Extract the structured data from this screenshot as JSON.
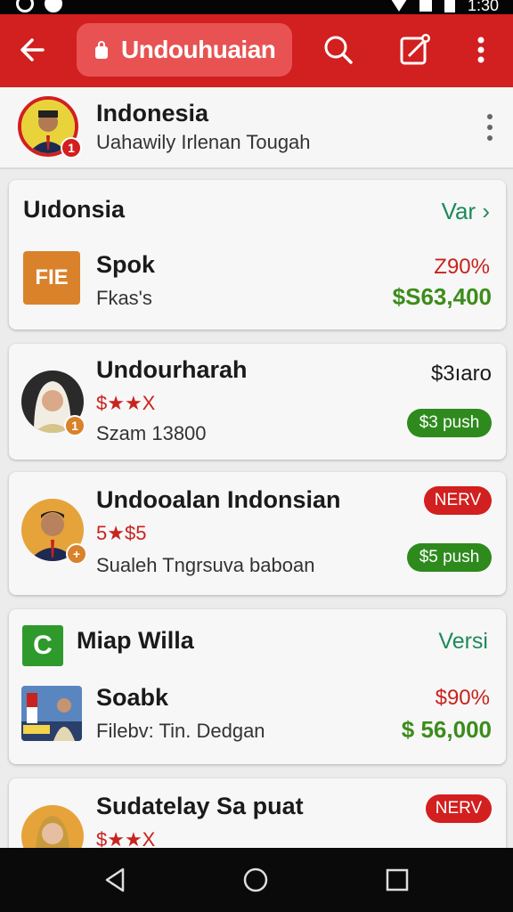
{
  "status_bar": {
    "time": "1:30"
  },
  "app_bar": {
    "title": "Undouhuaian",
    "back_icon": "arrow-left-icon",
    "search_icon": "search-icon",
    "compose_icon": "edit-note-icon",
    "more_icon": "more-vert-icon"
  },
  "profile": {
    "name": "Indonesia",
    "subtitle": "Uahawily Irlenan Tougah",
    "badge": "1"
  },
  "cards": [
    {
      "header": "Uıdonsia",
      "link": "Var",
      "logo_text": "FIE",
      "title": "Spok",
      "subtitle": "Fkas's",
      "percent": "Z90%",
      "price": "$S63,400"
    },
    {
      "title": "Undourharah",
      "rating": "$★★X",
      "detail": "Szam 13800",
      "value": "$3ıaro",
      "action": "$3 push",
      "badge": "1"
    },
    {
      "title": "Undooalan Indonsian",
      "rating": "5★$5",
      "detail": "Sualeh Tngrsuva baboan",
      "tag": "NERV",
      "action": "$5 push",
      "badge": "+"
    },
    {
      "header": "Miap Willa",
      "header_logo": "C",
      "link": "Versi",
      "title": "Soabk",
      "subtitle": "Filebv: Tin. Dedgan",
      "percent": "$90%",
      "price": "$ 56,000"
    },
    {
      "title": "Sudatelay Sa puat",
      "rating": "$★★X",
      "tag": "NERV"
    }
  ],
  "colors": {
    "primary": "#d21f1f",
    "accent_green": "#2e8a1d",
    "logo_orange": "#d9822b",
    "logo_green": "#2f9a2c"
  },
  "nav_bar": {
    "back_icon": "triangle-back-icon",
    "home_icon": "circle-home-icon",
    "recents_icon": "square-recents-icon"
  }
}
